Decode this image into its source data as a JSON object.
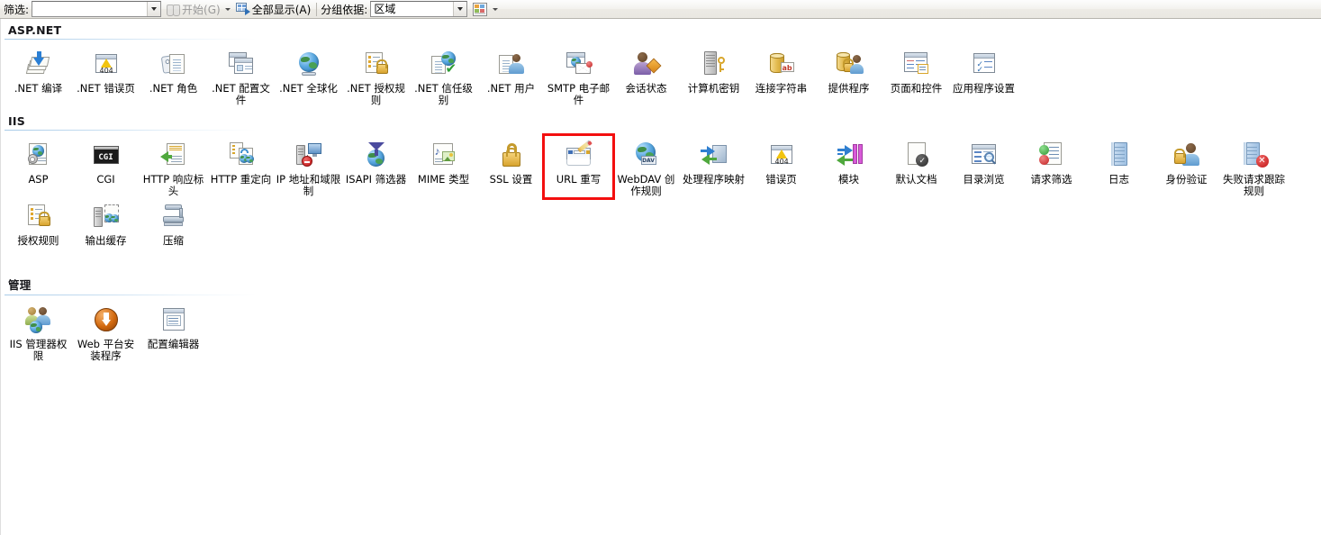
{
  "toolbar": {
    "filter_label": "筛选:",
    "filter_value": "",
    "start_label": "开始(G)",
    "show_all_label": "全部显示(A)",
    "group_by_label": "分组依据:",
    "group_by_value": "区域"
  },
  "sections": [
    {
      "title": "ASP.NET",
      "items": [
        {
          "label": ".NET 编译",
          "icon": "net-compilation-icon"
        },
        {
          "label": ".NET 错误页",
          "icon": "net-error-pages-icon"
        },
        {
          "label": ".NET 角色",
          "icon": "net-roles-icon"
        },
        {
          "label": ".NET 配置文件",
          "icon": "net-profile-icon"
        },
        {
          "label": ".NET 全球化",
          "icon": "net-globalization-icon"
        },
        {
          "label": ".NET 授权规则",
          "icon": "net-authorization-rules-icon"
        },
        {
          "label": ".NET 信任级别",
          "icon": "net-trust-levels-icon"
        },
        {
          "label": ".NET 用户",
          "icon": "net-users-icon"
        },
        {
          "label": "SMTP 电子邮件",
          "icon": "smtp-email-icon"
        },
        {
          "label": "会话状态",
          "icon": "session-state-icon"
        },
        {
          "label": "计算机密钥",
          "icon": "machine-key-icon"
        },
        {
          "label": "连接字符串",
          "icon": "connection-strings-icon"
        },
        {
          "label": "提供程序",
          "icon": "providers-icon"
        },
        {
          "label": "页面和控件",
          "icon": "pages-and-controls-icon"
        },
        {
          "label": "应用程序设置",
          "icon": "application-settings-icon"
        }
      ]
    },
    {
      "title": "IIS",
      "items": [
        {
          "label": "ASP",
          "icon": "asp-icon"
        },
        {
          "label": "CGI",
          "icon": "cgi-icon"
        },
        {
          "label": "HTTP 响应标头",
          "icon": "http-response-headers-icon"
        },
        {
          "label": "HTTP 重定向",
          "icon": "http-redirect-icon"
        },
        {
          "label": "IP 地址和域限制",
          "icon": "ip-address-domain-restrictions-icon"
        },
        {
          "label": "ISAPI 筛选器",
          "icon": "isapi-filters-icon"
        },
        {
          "label": "MIME 类型",
          "icon": "mime-types-icon"
        },
        {
          "label": "SSL 设置",
          "icon": "ssl-settings-icon"
        },
        {
          "label": "URL 重写",
          "icon": "url-rewrite-icon",
          "selected": true
        },
        {
          "label": "WebDAV 创作规则",
          "icon": "webdav-authoring-rules-icon"
        },
        {
          "label": "处理程序映射",
          "icon": "handler-mappings-icon"
        },
        {
          "label": "错误页",
          "icon": "error-pages-icon"
        },
        {
          "label": "模块",
          "icon": "modules-icon"
        },
        {
          "label": "默认文档",
          "icon": "default-document-icon"
        },
        {
          "label": "目录浏览",
          "icon": "directory-browsing-icon"
        },
        {
          "label": "请求筛选",
          "icon": "request-filtering-icon"
        },
        {
          "label": "日志",
          "icon": "logging-icon"
        },
        {
          "label": "身份验证",
          "icon": "authentication-icon"
        },
        {
          "label": "失败请求跟踪规则",
          "icon": "failed-request-tracing-rules-icon"
        },
        {
          "label": "授权规则",
          "icon": "authorization-rules-icon"
        },
        {
          "label": "输出缓存",
          "icon": "output-caching-icon"
        },
        {
          "label": "压缩",
          "icon": "compression-icon"
        }
      ]
    },
    {
      "title": "管理",
      "items": [
        {
          "label": "IIS 管理器权限",
          "icon": "iis-manager-permissions-icon"
        },
        {
          "label": "Web 平台安装程序",
          "icon": "web-platform-installer-icon"
        },
        {
          "label": "配置编辑器",
          "icon": "configuration-editor-icon"
        }
      ]
    }
  ],
  "colors": {
    "highlight": "#f41111",
    "section_rule": "#a8cbe8",
    "toolbar_bg": "#eceae5"
  }
}
